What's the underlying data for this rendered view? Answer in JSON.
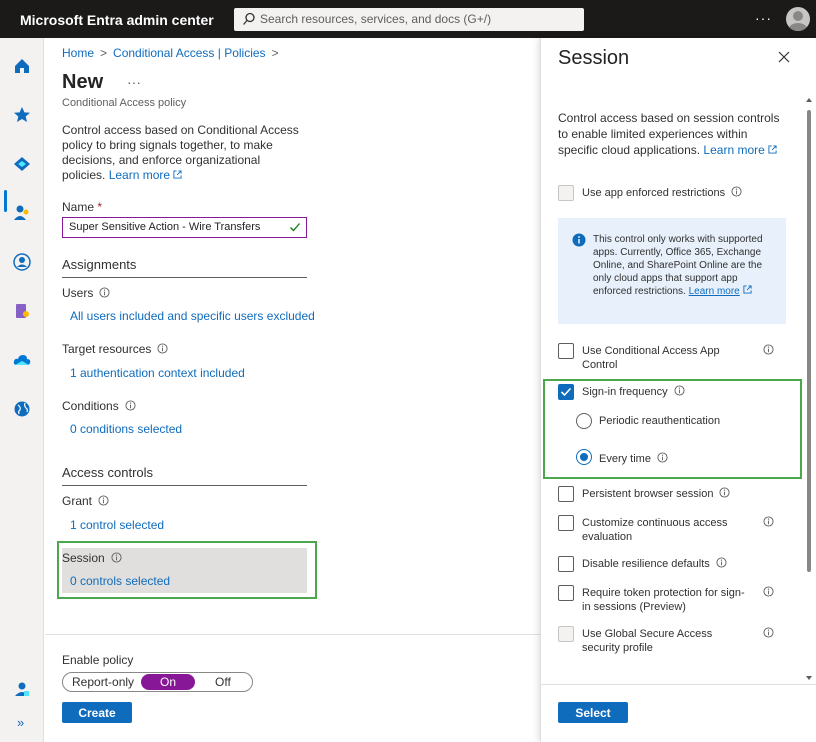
{
  "topbar": {
    "brand": "Microsoft Entra admin center",
    "search_placeholder": "Search resources, services, and docs (G+/)",
    "more": "···"
  },
  "leftnav": {
    "items": [
      "home-icon",
      "favorites-icon",
      "identity-icon",
      "users-icon",
      "groups-icon",
      "roles-icon",
      "cloud-icon",
      "global-icon",
      "learn-icon",
      "expand-icon"
    ],
    "expand_label": "»"
  },
  "breadcrumb": {
    "home": "Home",
    "policies": "Conditional Access | Policies"
  },
  "page": {
    "title": "New",
    "more": "···",
    "subtitle": "Conditional Access policy",
    "description": "Control access based on Conditional Access policy to bring signals together, to make decisions, and enforce organizational policies.",
    "learn_more": "Learn more"
  },
  "name_field": {
    "label": "Name",
    "required_mark": "*",
    "value": "Super Sensitive Action - Wire Transfers"
  },
  "assignments": {
    "heading": "Assignments",
    "users_label": "Users",
    "users_value": "All users included and specific users excluded",
    "targets_label": "Target resources",
    "targets_value": "1 authentication context included",
    "conditions_label": "Conditions",
    "conditions_value": "0 conditions selected"
  },
  "access_controls": {
    "heading": "Access controls",
    "grant_label": "Grant",
    "grant_value": "1 control selected",
    "session_label": "Session",
    "session_value": "0 controls selected"
  },
  "enable_policy": {
    "label": "Enable policy",
    "options": [
      "Report-only",
      "On",
      "Off"
    ],
    "selected": "On"
  },
  "create_button": "Create",
  "colors": {
    "accent": "#0f6cbd",
    "toggle_on": "#881798",
    "highlight_green": "#4ca64c",
    "topbar": "#1b1a19"
  },
  "session_panel": {
    "title": "Session",
    "description": "Control access based on session controls to enable limited experiences within specific cloud applications.",
    "learn_more": "Learn more",
    "app_enforced": {
      "label": "Use app enforced restrictions",
      "checked": false,
      "disabled": true
    },
    "info_box": {
      "text": "This control only works with supported apps. Currently, Office 365, Exchange Online, and SharePoint Online are the only cloud apps that support app enforced restrictions.",
      "learn_more": "Learn more"
    },
    "ca_app_control": {
      "label": "Use Conditional Access App Control",
      "checked": false
    },
    "signin_frequency": {
      "label": "Sign-in frequency",
      "checked": true
    },
    "periodic": {
      "label": "Periodic reauthentication",
      "selected": false
    },
    "every_time": {
      "label": "Every time",
      "selected": true
    },
    "persistent": {
      "label": "Persistent browser session",
      "checked": false
    },
    "cae": {
      "label": "Customize continuous access evaluation",
      "checked": false
    },
    "resilience": {
      "label": "Disable resilience defaults",
      "checked": false
    },
    "token_protection": {
      "label": "Require token protection for sign-in sessions (Preview)",
      "checked": false
    },
    "gsa": {
      "label": "Use Global Secure Access security profile",
      "checked": false,
      "disabled": true
    },
    "select_button": "Select"
  }
}
